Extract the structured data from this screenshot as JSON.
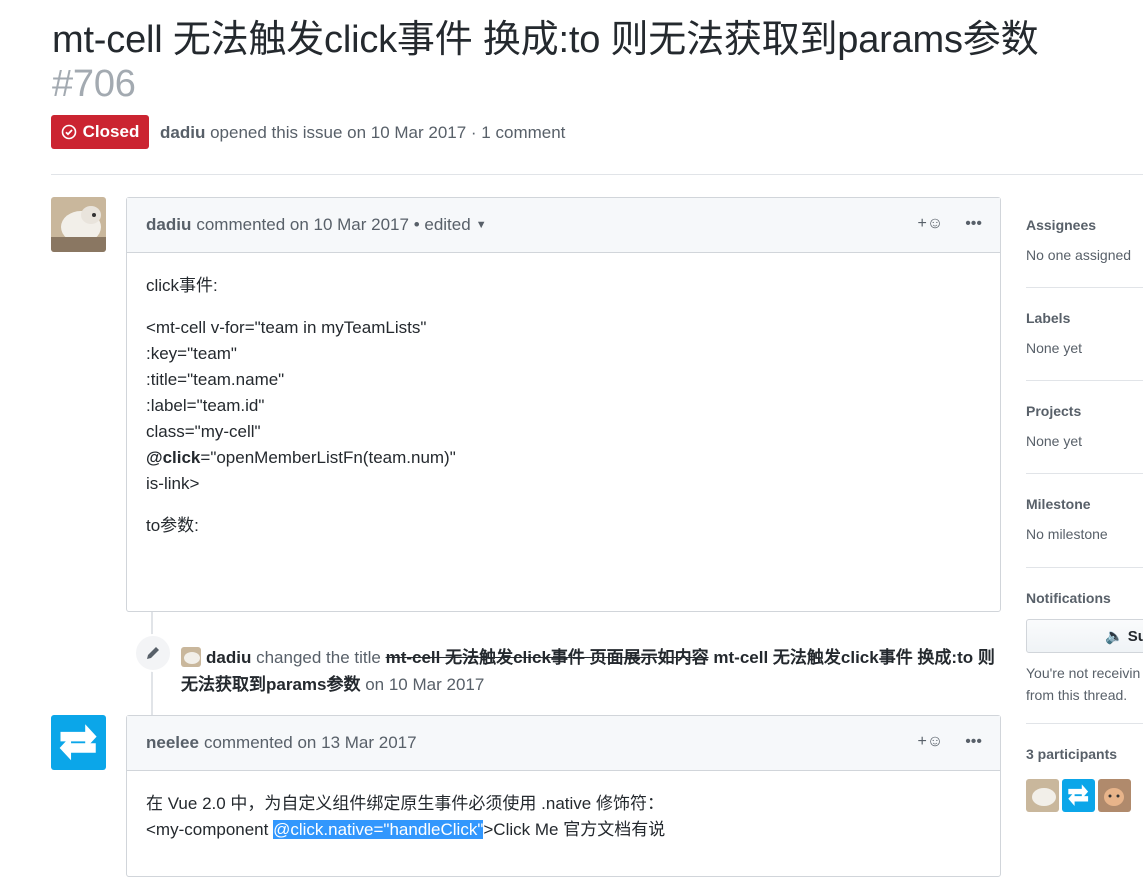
{
  "issue": {
    "title": "mt-cell 无法触发click事件 换成:to 则无法获取到params参数",
    "number": "#706",
    "state": "Closed",
    "author": "dadiu",
    "meta_text": "opened this issue on 10 Mar 2017 · 1 comment"
  },
  "comment1": {
    "author": "dadiu",
    "header_text": "commented on 10 Mar 2017 • edited",
    "intro": "click事件:",
    "code_lines": [
      "<mt-cell v-for=\"team in myTeamLists\"",
      ":key=\"team\"",
      ":title=\"team.name\"",
      ":label=\"team.id\"",
      "class=\"my-cell\""
    ],
    "click_attr": "@click",
    "click_value": "=\"openMemberListFn(team.num)\"",
    "is_link": "is-link>",
    "outro": "to参数:"
  },
  "event": {
    "actor": "dadiu",
    "verb": "changed the title",
    "old_title": "mt-cell 无法触发click事件 页面展示如内容",
    "new_title": "mt-cell 无法触发click事件 换成:to 则无法获取到params参数",
    "date": "on 10 Mar 2017"
  },
  "comment2": {
    "author": "neelee",
    "header_text": "commented on 13 Mar 2017",
    "line1": "在 Vue 2.0 中，为自定义组件绑定原生事件必须使用 .native 修饰符：",
    "line2_pre": "<my-component ",
    "line2_sel": "@click.native=\"handleClick\"",
    "line2_post": ">Click Me 官方文档有说"
  },
  "sidebar": {
    "assignees_label": "Assignees",
    "assignees_value": "No one assigned",
    "labels_label": "Labels",
    "labels_value": "None yet",
    "projects_label": "Projects",
    "projects_value": "None yet",
    "milestone_label": "Milestone",
    "milestone_value": "No milestone",
    "notifications_label": "Notifications",
    "subscribe_label": "Su",
    "notification_note_1": "You're not receivin",
    "notification_note_2": "from this thread.",
    "participants_label": "3 participants"
  },
  "colors": {
    "closed_red": "#cb2431",
    "selection_blue": "#3297fd",
    "neelee_avatar_blue": "#0ba6e9"
  }
}
